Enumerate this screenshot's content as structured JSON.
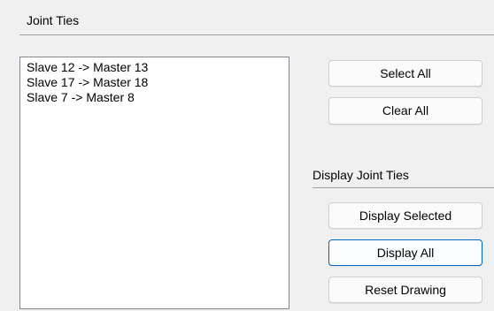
{
  "group": {
    "title": "Joint Ties"
  },
  "joint_ties_list": {
    "items": [
      "Slave 12 -> Master 13",
      "Slave 17 -> Master 18",
      "Slave 7 -> Master 8"
    ]
  },
  "buttons": {
    "select_all": "Select All",
    "clear_all": "Clear All"
  },
  "display_section": {
    "title": "Display Joint Ties",
    "display_selected": "Display Selected",
    "display_all": "Display All",
    "reset_drawing": "Reset Drawing"
  },
  "colors": {
    "focus_border": "#0067c0",
    "background": "#f0f0f0"
  }
}
